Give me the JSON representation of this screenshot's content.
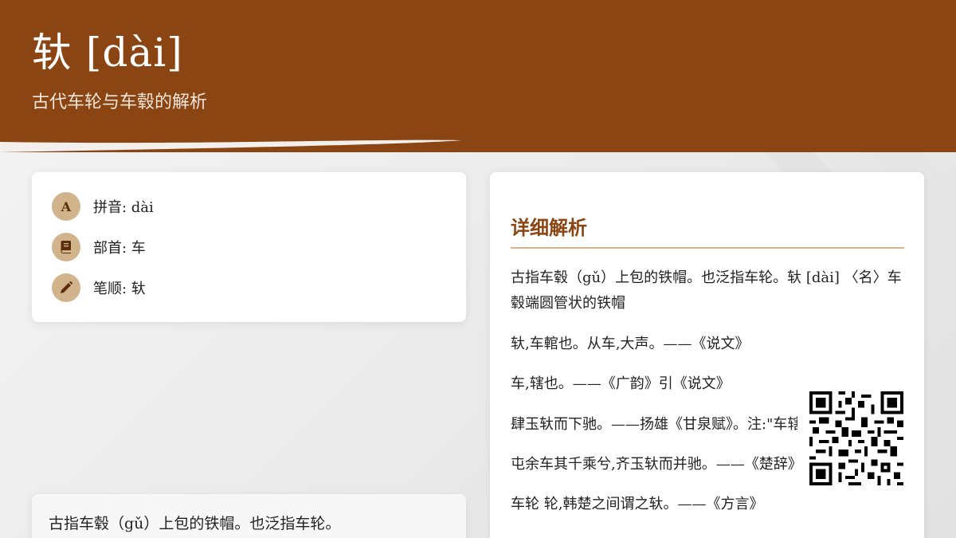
{
  "header": {
    "title": "轪 [dài]",
    "subtitle": "古代车轮与车毂的解析"
  },
  "info": {
    "items": [
      {
        "icon": "font-icon",
        "glyph": "A",
        "label": "拼音: dài"
      },
      {
        "icon": "book-icon",
        "glyph": "",
        "label": "部首: 车"
      },
      {
        "icon": "pencil-icon",
        "glyph": "",
        "label": "笔顺: 轪"
      }
    ]
  },
  "detail": {
    "title": "详细解析",
    "paragraphs": [
      "古指车毂（gǔ）上包的铁帽。也泛指车轮。轪 [dài] 〈名〉车毂端圆管状的铁帽",
      "轪,车輨也。从车,大声。——《说文》",
      "车,辖也。——《广韵》引《说文》",
      "肆玉轪而下驰。——扬雄《甘泉赋》。注:\"车辖",
      "屯余车其千乘兮,齐玉轪而并驰。——《楚辞》",
      "车轮 轮,韩楚之间谓之轪。——《方言》"
    ]
  },
  "summary": {
    "text": "古指车毂（gǔ）上包的铁帽。也泛指车轮。"
  },
  "colors": {
    "brand": "#8b4513",
    "accent": "#d2b48c"
  }
}
